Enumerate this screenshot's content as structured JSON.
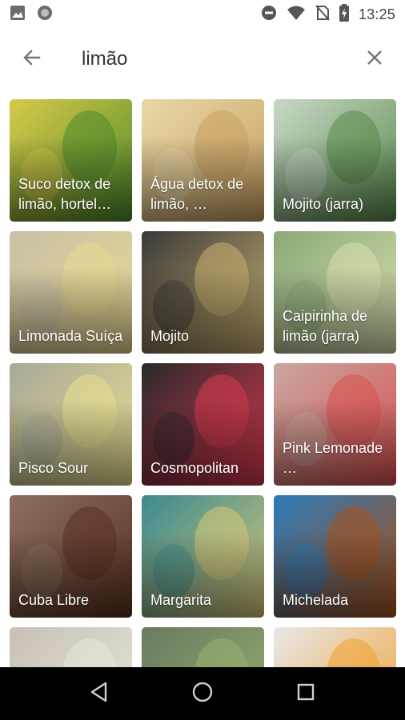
{
  "status": {
    "time": "13:25",
    "icons": [
      "image-icon",
      "circle-notification-icon",
      "do-not-disturb-icon",
      "wifi-icon",
      "no-sim-icon",
      "battery-charging-icon"
    ]
  },
  "search": {
    "query": "limão",
    "back_icon": "arrow-left-icon",
    "clear_icon": "close-icon"
  },
  "results": [
    {
      "title": "Suco detox de limão, hortel…",
      "colors": [
        "#d8c94a",
        "#4c8b2a"
      ]
    },
    {
      "title": "Água detox de limão, …",
      "colors": [
        "#e8d8a8",
        "#c8a060"
      ]
    },
    {
      "title": "Mojito (jarra)",
      "colors": [
        "#c8d8c8",
        "#5a8a4a"
      ]
    },
    {
      "title": "Limonada Suíça",
      "colors": [
        "#c8c0a8",
        "#e8d890"
      ]
    },
    {
      "title": "Mojito",
      "colors": [
        "#3a3a3a",
        "#c8b070"
      ]
    },
    {
      "title": "Caipirinha de limão (jarra)",
      "colors": [
        "#8aa878",
        "#d8e0b0"
      ]
    },
    {
      "title": "Pisco Sour",
      "colors": [
        "#a8a898",
        "#e8e090"
      ]
    },
    {
      "title": "Cosmopolitan",
      "colors": [
        "#2a2a2a",
        "#d83850"
      ]
    },
    {
      "title": "Pink Lemonade …",
      "colors": [
        "#c8a8a0",
        "#d85050"
      ]
    },
    {
      "title": "Cuba Libre",
      "colors": [
        "#8a7060",
        "#5a3020"
      ]
    },
    {
      "title": "Margarita",
      "colors": [
        "#3a8a90",
        "#d8c878"
      ]
    },
    {
      "title": "Michelada",
      "colors": [
        "#2a7ab8",
        "#a8501a"
      ]
    },
    {
      "title": "",
      "colors": [
        "#c8c0b8",
        "#e8e8d8"
      ]
    },
    {
      "title": "",
      "colors": [
        "#6a7a60",
        "#9ab070"
      ]
    },
    {
      "title": "",
      "colors": [
        "#e8e8e8",
        "#f0a030"
      ]
    }
  ],
  "nav": {
    "back_icon": "triangle-back-icon",
    "home_icon": "circle-home-icon",
    "recents_icon": "square-recents-icon"
  }
}
